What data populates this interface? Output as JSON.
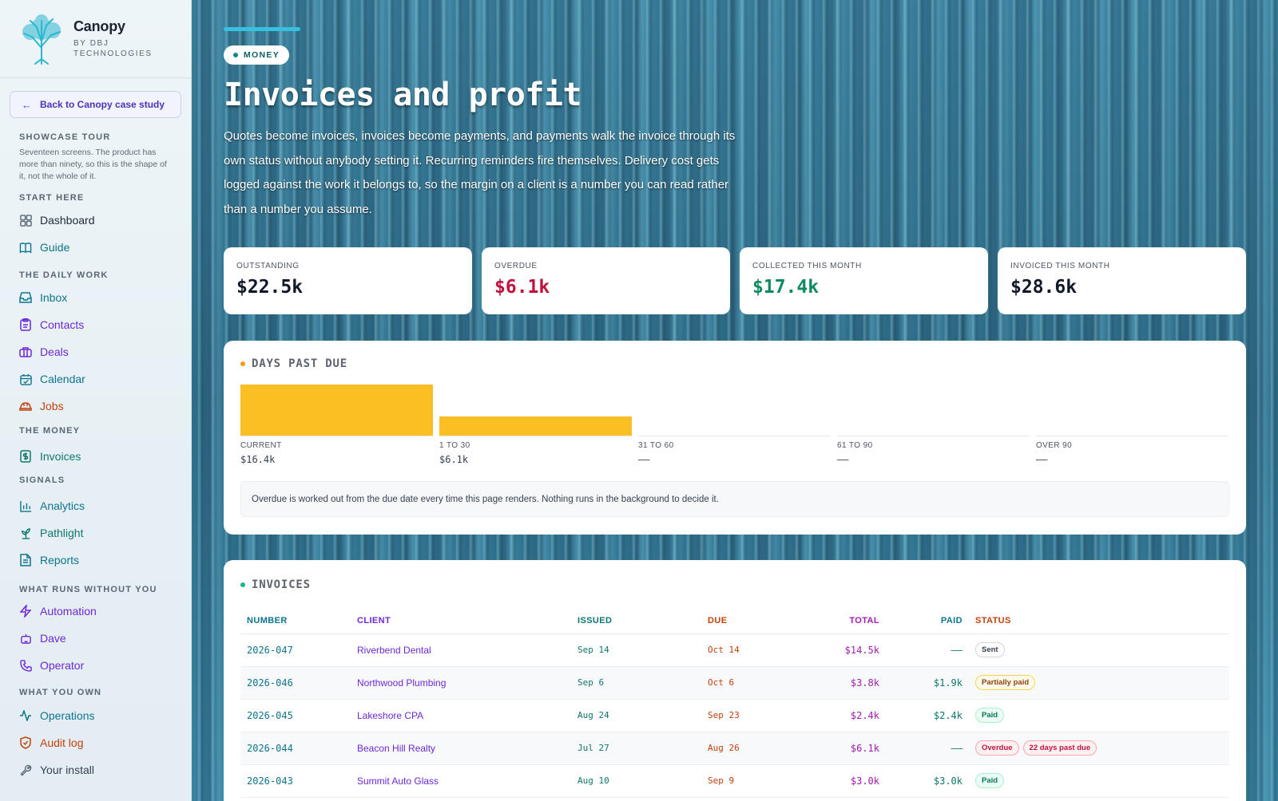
{
  "brand": {
    "name": "Canopy",
    "sub": "BY DBJ TECHNOLOGIES"
  },
  "back_button": "Back to Canopy case study",
  "tour": {
    "title": "SHOWCASE TOUR",
    "desc": "Seventeen screens. The product has more than ninety, so this is the shape of it, not the whole of it."
  },
  "sections": {
    "start": "START HERE",
    "daily": "THE DAILY WORK",
    "money": "THE MONEY",
    "signals": "SIGNALS",
    "runs": "WHAT RUNS WITHOUT YOU",
    "own": "WHAT YOU OWN"
  },
  "nav": {
    "dashboard": "Dashboard",
    "guide": "Guide",
    "inbox": "Inbox",
    "contacts": "Contacts",
    "deals": "Deals",
    "calendar": "Calendar",
    "jobs": "Jobs",
    "invoices": "Invoices",
    "analytics": "Analytics",
    "pathlight": "Pathlight",
    "reports": "Reports",
    "automation": "Automation",
    "dave": "Dave",
    "operator": "Operator",
    "operations": "Operations",
    "audit": "Audit log",
    "install": "Your install"
  },
  "hero": {
    "pill": "MONEY",
    "title": "Invoices and profit",
    "desc": "Quotes become invoices, invoices become payments, and payments walk the invoice through its own status without anybody setting it. Recurring reminders fire themselves. Delivery cost gets logged against the work it belongs to, so the margin on a client is a number you can read rather than a number you assume."
  },
  "stats": {
    "outstanding": {
      "label": "OUTSTANDING",
      "value": "$22.5k"
    },
    "overdue": {
      "label": "OVERDUE",
      "value": "$6.1k"
    },
    "collected": {
      "label": "COLLECTED THIS MONTH",
      "value": "$17.4k"
    },
    "invoiced": {
      "label": "INVOICED THIS MONTH",
      "value": "$28.6k"
    }
  },
  "aging": {
    "title": "DAYS PAST DUE",
    "buckets": [
      {
        "label": "CURRENT",
        "value": "$16.4k",
        "amount": 16.4
      },
      {
        "label": "1 TO 30",
        "value": "$6.1k",
        "amount": 6.1
      },
      {
        "label": "31 TO 60",
        "value": "——",
        "amount": 0
      },
      {
        "label": "61 TO 90",
        "value": "——",
        "amount": 0
      },
      {
        "label": "OVER 90",
        "value": "——",
        "amount": 0
      }
    ],
    "note": "Overdue is worked out from the due date every time this page renders. Nothing runs in the background to decide it."
  },
  "invoices": {
    "title": "INVOICES",
    "headers": {
      "number": "NUMBER",
      "client": "CLIENT",
      "issued": "ISSUED",
      "due": "DUE",
      "total": "TOTAL",
      "paid": "PAID",
      "status": "STATUS"
    },
    "rows": [
      {
        "number": "2026-047",
        "client": "Riverbend Dental",
        "issued": "Sep 14",
        "due": "Oct 14",
        "total": "$14.5k",
        "paid": "——",
        "status": "Sent"
      },
      {
        "number": "2026-046",
        "client": "Northwood Plumbing",
        "issued": "Sep 6",
        "due": "Oct 6",
        "total": "$3.8k",
        "paid": "$1.9k",
        "status": "Partially paid"
      },
      {
        "number": "2026-045",
        "client": "Lakeshore CPA",
        "issued": "Aug 24",
        "due": "Sep 23",
        "total": "$2.4k",
        "paid": "$2.4k",
        "status": "Paid"
      },
      {
        "number": "2026-044",
        "client": "Beacon Hill Realty",
        "issued": "Jul 27",
        "due": "Aug 26",
        "total": "$6.1k",
        "paid": "——",
        "status": "Overdue",
        "extra": "22 days past due"
      },
      {
        "number": "2026-043",
        "client": "Summit Auto Glass",
        "issued": "Aug 10",
        "due": "Sep 9",
        "total": "$3.0k",
        "paid": "$3.0k",
        "status": "Paid"
      }
    ]
  },
  "colors": {
    "accent": "#38c0e0",
    "overdue": "#be123c",
    "collected": "#0f8a5f",
    "bar": "#fbbf24"
  }
}
